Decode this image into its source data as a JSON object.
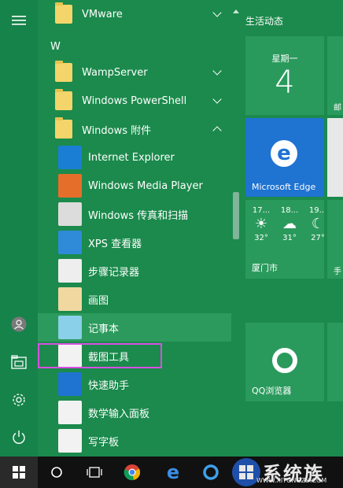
{
  "rail": {
    "items": [
      {
        "name": "hamburger-menu-icon"
      },
      {
        "name": "user-avatar-icon"
      },
      {
        "name": "file-explorer-icon"
      },
      {
        "name": "settings-gear-icon"
      },
      {
        "name": "power-icon"
      }
    ]
  },
  "applist": {
    "section_letter": "W",
    "vmware": "VMware",
    "wamp": "WampServer",
    "powershell": "Windows PowerShell",
    "accessories": "Windows 附件",
    "sub_items": [
      {
        "label": "Internet Explorer",
        "icon": "ie-icon",
        "color": "#1a7fd4"
      },
      {
        "label": "Windows Media Player",
        "icon": "media-player-icon",
        "color": "#e56f2a"
      },
      {
        "label": "Windows 传真和扫描",
        "icon": "fax-scan-icon",
        "color": "#dcdcdc"
      },
      {
        "label": "XPS 查看器",
        "icon": "xps-viewer-icon",
        "color": "#2f8ad8"
      },
      {
        "label": "步骤记录器",
        "icon": "steps-recorder-icon",
        "color": "#eeeeee"
      },
      {
        "label": "画图",
        "icon": "paint-icon",
        "color": "#f0d8a0"
      },
      {
        "label": "记事本",
        "icon": "notepad-icon",
        "color": "#8ad0e8"
      },
      {
        "label": "截图工具",
        "icon": "snipping-tool-icon",
        "color": "#f2f2f2"
      },
      {
        "label": "快速助手",
        "icon": "quick-assist-icon",
        "color": "#1f73d1"
      },
      {
        "label": "数学输入面板",
        "icon": "math-input-icon",
        "color": "#f2f2f2"
      },
      {
        "label": "写字板",
        "icon": "wordpad-icon",
        "color": "#f2f2f2"
      }
    ]
  },
  "tiles": {
    "group_title": "生活动态",
    "calendar": {
      "day": "星期一",
      "date": "4"
    },
    "mail_peek": "邮",
    "edge": "Microsoft Edge",
    "weather": {
      "days": [
        {
          "date": "17...",
          "temp": "32°",
          "icon": "sun-icon"
        },
        {
          "date": "18...",
          "temp": "31°",
          "icon": "cloud-icon"
        },
        {
          "date": "19...",
          "temp": "27°",
          "icon": "moon-icon"
        }
      ],
      "city": "厦门市"
    },
    "hand_peek": "手",
    "qq": "QQ浏览器"
  },
  "taskbar": {
    "items": [
      {
        "name": "start-button-icon"
      },
      {
        "name": "cortana-search-icon"
      },
      {
        "name": "task-view-icon"
      },
      {
        "name": "chrome-icon"
      },
      {
        "name": "edge-icon"
      },
      {
        "name": "qq-browser-icon"
      }
    ]
  },
  "watermark": {
    "text": "系统族",
    "sub": "WWW.XITONGZU.COM"
  },
  "colors": {
    "background": "#1b8a4c",
    "tile": "#2a9a5c",
    "edge_tile": "#1f73d1",
    "highlight_border": "#d94fe3",
    "taskbar": "#111111"
  }
}
